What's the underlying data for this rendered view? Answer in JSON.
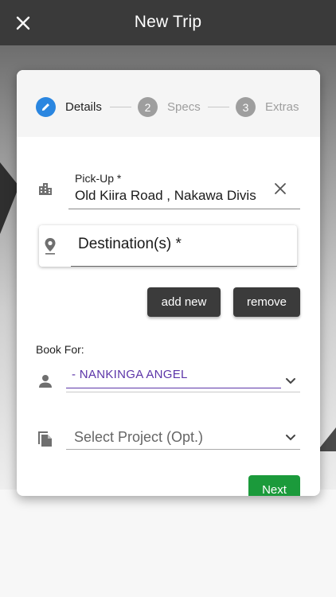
{
  "appbar": {
    "title": "New Trip",
    "close_icon": "close-icon"
  },
  "stepper": {
    "steps": [
      {
        "label": "Details",
        "state": "active",
        "icon": "pencil-icon"
      },
      {
        "number": "2",
        "label": "Specs",
        "state": "inactive"
      },
      {
        "number": "3",
        "label": "Extras",
        "state": "inactive"
      }
    ]
  },
  "pickup": {
    "label": "Pick-Up *",
    "value": "Old Kiira Road , Nakawa Division",
    "icon": "building-icon"
  },
  "destination": {
    "placeholder": "Destination(s) *",
    "icon": "location-pin-icon"
  },
  "actions": {
    "add_label": "add new",
    "remove_label": "remove"
  },
  "book_for": {
    "label": "Book For:",
    "value": "- NANKINGA ANGEL",
    "icon": "person-icon"
  },
  "project": {
    "placeholder": "Select Project (Opt.)",
    "icon": "file-copy-icon"
  },
  "next": {
    "label": "Next"
  },
  "colors": {
    "accent": "#2a86e0",
    "purple": "#5c35a8",
    "green": "#1b9a3b",
    "appbar": "#3a3a3a"
  }
}
